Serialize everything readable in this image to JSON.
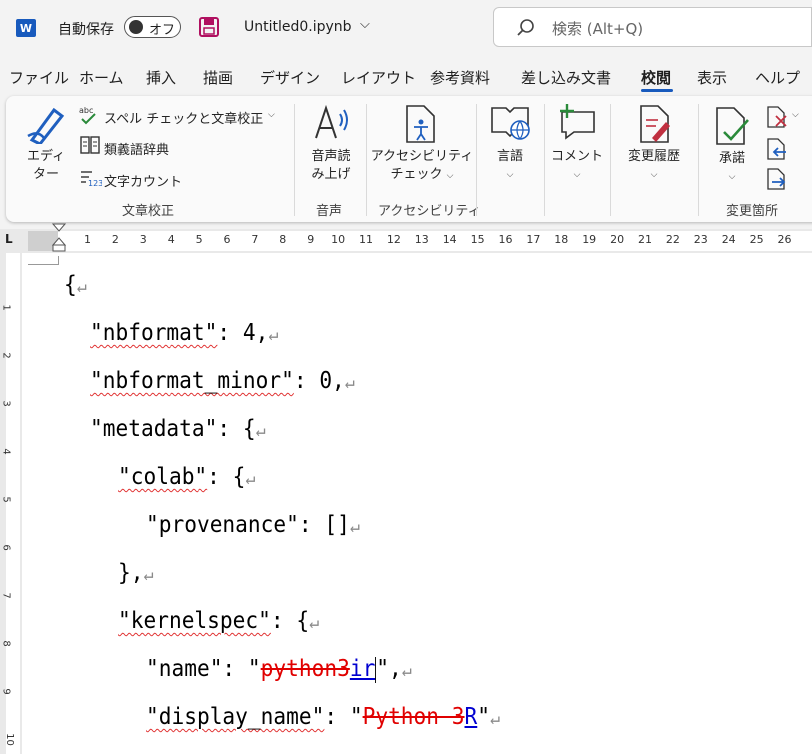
{
  "titlebar": {
    "app_icon": "W",
    "autosave_label": "自動保存",
    "autosave_state": "オフ",
    "filename": "Untitled0.ipynb",
    "search_placeholder": "検索 (Alt+Q)"
  },
  "tabs": [
    "ファイル",
    "ホーム",
    "挿入",
    "描画",
    "デザイン",
    "レイアウト",
    "参考資料",
    "差し込み文書",
    "校閲",
    "表示",
    "ヘルプ"
  ],
  "active_tab": "校閲",
  "ribbon": {
    "editor_label_1": "エディ",
    "editor_label_2": "ター",
    "spell_check": "スペル チェックと文章校正",
    "thesaurus": "類義語辞典",
    "word_count": "文字カウント",
    "group_proofing": "文章校正",
    "read_aloud_1": "音声読",
    "read_aloud_2": "み上げ",
    "group_speech": "音声",
    "accessibility_1": "アクセシビリティ",
    "accessibility_2": "チェック",
    "group_accessibility": "アクセシビリティ",
    "language": "言語",
    "comment": "コメント",
    "track_changes": "変更履歴",
    "accept": "承諾",
    "group_changes": "変更箇所"
  },
  "ruler": {
    "horizontal_ticks": [
      "1",
      "2",
      "3",
      "4",
      "5",
      "6",
      "7",
      "8",
      "9",
      "10",
      "11",
      "12",
      "13",
      "14",
      "15",
      "16",
      "17",
      "18",
      "19",
      "20",
      "21",
      "22",
      "23",
      "24",
      "25",
      "26"
    ],
    "vertical_ticks": [
      "1",
      "2",
      "3",
      "4",
      "5",
      "6",
      "7",
      "8",
      "9",
      "10"
    ]
  },
  "document": {
    "l1": "{",
    "l2_key": "\"nbformat\"",
    "l2_rest": ": 4,",
    "l3_key": "\"nbformat_minor\"",
    "l3_rest": ": 0,",
    "l4": "\"metadata\": {",
    "l5_key": "\"colab\"",
    "l5_rest": ": {",
    "l6": "\"provenance\": []",
    "l7": "},",
    "l8_key": "\"kernelspec\"",
    "l8_rest": ": {",
    "l9_key": "\"name\": \"",
    "l9_deleted": "python3",
    "l9_inserted": "ir",
    "l9_rest": "\",",
    "l10_key": "\"display_name\"",
    "l10_mid": ": \"",
    "l10_deleted": "Python 3",
    "l10_inserted": "R",
    "l10_rest": "\"",
    "paragraph_mark": "↵"
  }
}
